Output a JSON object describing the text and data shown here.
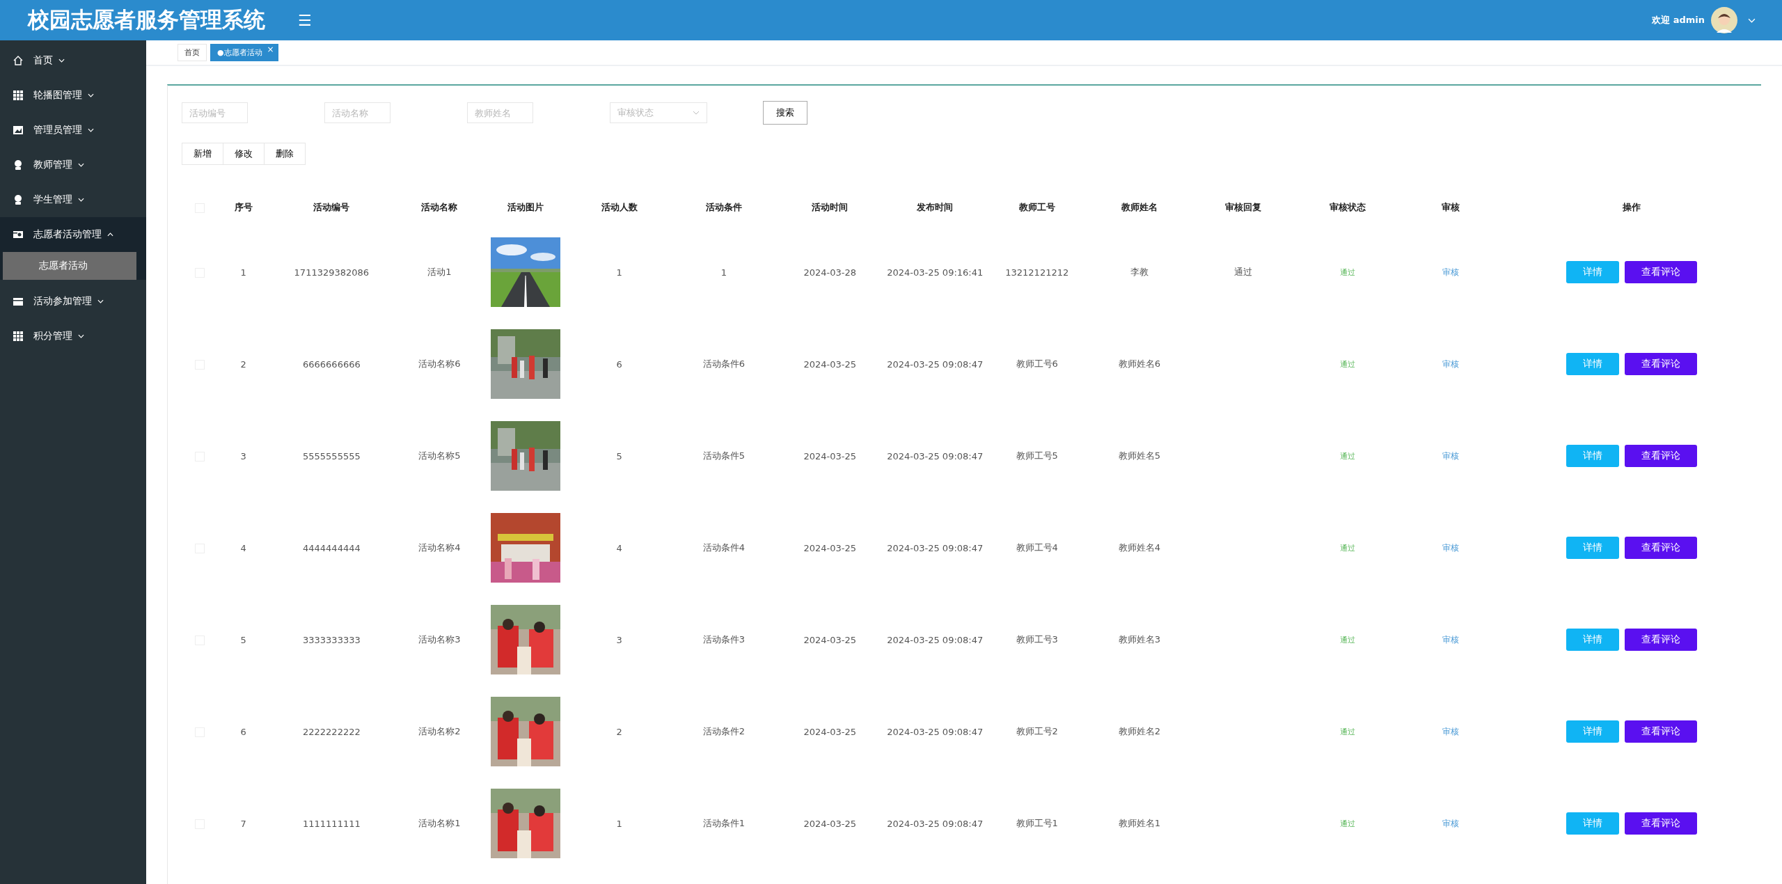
{
  "header": {
    "title": "校园志愿者服务管理系统",
    "menu_icon": "☰",
    "welcome": "欢迎 admin"
  },
  "sidebar": {
    "items": [
      {
        "label": "首页",
        "expanded": false
      },
      {
        "label": "轮播图管理",
        "expanded": false
      },
      {
        "label": "管理员管理",
        "expanded": false
      },
      {
        "label": "教师管理",
        "expanded": false
      },
      {
        "label": "学生管理",
        "expanded": false
      },
      {
        "label": "志愿者活动管理",
        "expanded": true,
        "children": [
          {
            "label": "志愿者活动",
            "selected": true
          }
        ]
      },
      {
        "label": "活动参加管理",
        "expanded": false
      },
      {
        "label": "积分管理",
        "expanded": false
      }
    ]
  },
  "tabs": [
    {
      "label": "首页",
      "selected": false
    },
    {
      "label": "●志愿者活动",
      "selected": true,
      "close": "×"
    }
  ],
  "search": {
    "fields": [
      {
        "kind": "input",
        "placeholder": "活动编号"
      },
      {
        "kind": "input",
        "placeholder": "活动名称"
      },
      {
        "kind": "input",
        "placeholder": "教师姓名"
      },
      {
        "kind": "select",
        "placeholder": "审核状态"
      }
    ],
    "button": "搜索"
  },
  "actions": [
    "新增",
    "修改",
    "删除"
  ],
  "table": {
    "header_checked": false,
    "columns": [
      "序号",
      "活动编号",
      "活动名称",
      "活动图片",
      "活动人数",
      "活动条件",
      "活动时间",
      "发布时间",
      "教师工号",
      "教师姓名",
      "审核回复",
      "审核状态",
      "审核",
      "操作"
    ],
    "rows": [
      {
        "checked": false,
        "index": "1",
        "code": "1711329382086",
        "name": "活动1",
        "count": "1",
        "condition": "1",
        "date": "2024-03-28",
        "published": "2024-03-25 09:16:41",
        "teacher_id": "13212121212",
        "teacher": "李教",
        "reply": "通过",
        "status": "通过",
        "audit": "审核",
        "buttons": [
          "详情",
          "查看评论"
        ]
      },
      {
        "checked": false,
        "index": "2",
        "code": "6666666666",
        "name": "活动名称6",
        "count": "6",
        "condition": "活动条件6",
        "date": "2024-03-25",
        "published": "2024-03-25 09:08:47",
        "teacher_id": "教师工号6",
        "teacher": "教师姓名6",
        "status": "通过",
        "audit": "审核",
        "buttons": [
          "详情",
          "查看评论"
        ]
      },
      {
        "checked": false,
        "index": "3",
        "code": "5555555555",
        "name": "活动名称5",
        "count": "5",
        "condition": "活动条件5",
        "date": "2024-03-25",
        "published": "2024-03-25 09:08:47",
        "teacher_id": "教师工号5",
        "teacher": "教师姓名5",
        "status": "通过",
        "audit": "审核",
        "buttons": [
          "详情",
          "查看评论"
        ]
      },
      {
        "checked": false,
        "index": "4",
        "code": "4444444444",
        "name": "活动名称4",
        "count": "4",
        "condition": "活动条件4",
        "date": "2024-03-25",
        "published": "2024-03-25 09:08:47",
        "teacher_id": "教师工号4",
        "teacher": "教师姓名4",
        "status": "通过",
        "audit": "审核",
        "buttons": [
          "详情",
          "查看评论"
        ]
      },
      {
        "checked": false,
        "index": "5",
        "code": "3333333333",
        "name": "活动名称3",
        "count": "3",
        "condition": "活动条件3",
        "date": "2024-03-25",
        "published": "2024-03-25 09:08:47",
        "teacher_id": "教师工号3",
        "teacher": "教师姓名3",
        "status": "通过",
        "audit": "审核",
        "buttons": [
          "详情",
          "查看评论"
        ]
      },
      {
        "checked": false,
        "index": "6",
        "code": "2222222222",
        "name": "活动名称2",
        "count": "2",
        "condition": "活动条件2",
        "date": "2024-03-25",
        "published": "2024-03-25 09:08:47",
        "teacher_id": "教师工号2",
        "teacher": "教师姓名2",
        "status": "通过",
        "audit": "审核",
        "buttons": [
          "详情",
          "查看评论"
        ]
      },
      {
        "checked": false,
        "index": "7",
        "code": "1111111111",
        "name": "活动名称1",
        "count": "1",
        "condition": "活动条件1",
        "date": "2024-03-25",
        "published": "2024-03-25 09:08:47",
        "teacher_id": "教师工号1",
        "teacher": "教师姓名1",
        "status": "通过",
        "audit": "审核",
        "buttons": [
          "详情",
          "查看评论"
        ]
      }
    ]
  }
}
